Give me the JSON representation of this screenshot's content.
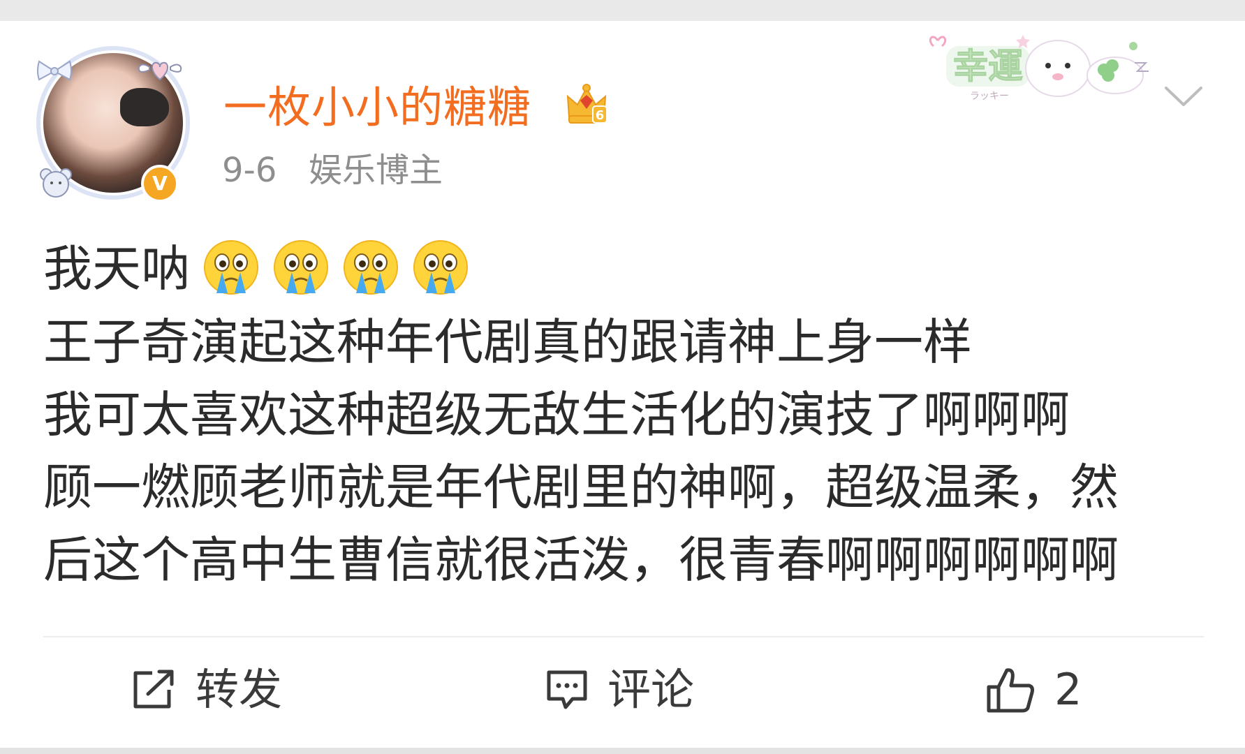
{
  "user": {
    "name": "一枚小小的糖糖",
    "date": "9-6",
    "tag": "娱乐博主",
    "verified_badge": "V",
    "avatar_icon": "avatar",
    "crown_level": "6",
    "name_color": "#f26d1f",
    "verified_color": "#f5a623"
  },
  "decor_badge": {
    "text": "幸運",
    "subtext": "ラッキー"
  },
  "post": {
    "lines": [
      "我天呐",
      "王子奇演起这种年代剧真的跟请神上身一样",
      "我可太喜欢这种超级无敌生活化的演技了啊啊啊",
      "顾一燃顾老师就是年代剧里的神啊，超级温柔，然",
      "后这个高中生曹信就很活泼，很青春啊啊啊啊啊啊"
    ],
    "emojis": [
      "crying-emoji",
      "crying-emoji",
      "crying-emoji",
      "crying-emoji"
    ]
  },
  "actions": {
    "repost_label": "转发",
    "comment_label": "评论",
    "like_count": "2"
  }
}
